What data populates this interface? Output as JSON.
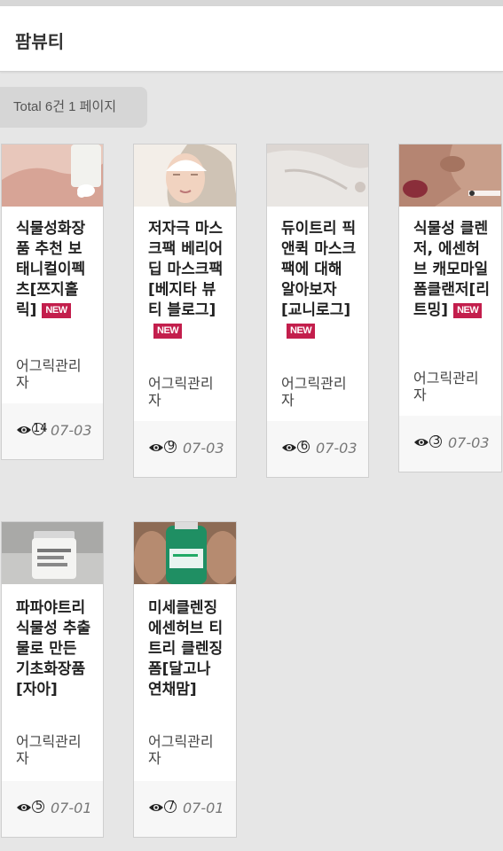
{
  "header": {
    "title": "팜뷰티"
  },
  "summary": {
    "total_label": "Total 6건 1 페이지"
  },
  "posts": [
    {
      "title": "식물성화장품 추천 보태니컬이펙츠[쯔지홀릭]",
      "new_badge": "NEW",
      "author": "어그릭관리자",
      "views": "14",
      "date": "07-03",
      "thumb": "hand-cream"
    },
    {
      "title": "저자극 마스크팩 베리어 딥 마스크팩[베지타 뷰티 블로그]",
      "new_badge": "NEW",
      "author": "어그릭관리자",
      "views": "9",
      "date": "07-03",
      "thumb": "face-towel"
    },
    {
      "title": "듀이트리 픽앤퀵 마스크팩에 대해 알아보자 [교니로그]",
      "new_badge": "NEW",
      "author": "어그릭관리자",
      "views": "6",
      "date": "07-03",
      "thumb": "mask-sheet"
    },
    {
      "title": "식물성 클렌저, 에센허브 캐모마일 폼클랜저[리트밍]",
      "new_badge": "NEW",
      "author": "어그릭관리자",
      "views": "3",
      "date": "07-03",
      "thumb": "skin-closeup"
    },
    {
      "title": "파파야트리 식물성 추출물로 만든 기초화장품[자아]",
      "new_badge": "",
      "author": "어그릭관리자",
      "views": "5",
      "date": "07-01",
      "thumb": "cream-jar"
    },
    {
      "title": "미세클렌징 에센허브 티트리 클렌징폼[달고나 연채맘]",
      "new_badge": "",
      "author": "어그릭관리자",
      "views": "7",
      "date": "07-01",
      "thumb": "green-bottle"
    }
  ]
}
